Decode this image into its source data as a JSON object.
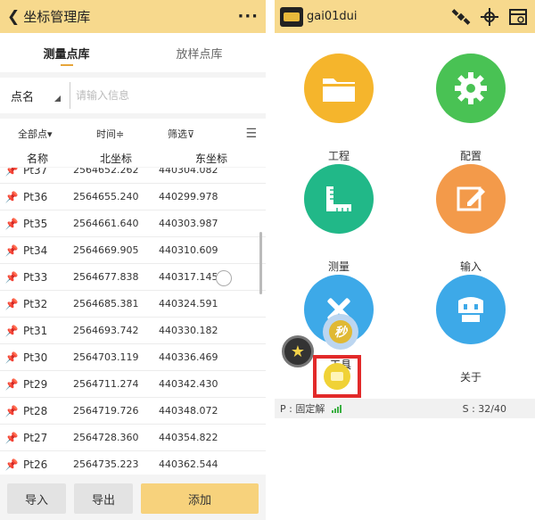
{
  "left": {
    "header": {
      "title": "坐标管理库",
      "back_icon": "chevron-left-icon",
      "more_label": "···"
    },
    "tabs": [
      {
        "label": "测量点库",
        "active": true
      },
      {
        "label": "放样点库",
        "active": false
      }
    ],
    "search": {
      "field_label": "点名",
      "placeholder": "请输入信息",
      "value": ""
    },
    "filters": {
      "all_points": "全部点▾",
      "time": "时间≑",
      "filter": "筛选⊽"
    },
    "columns": {
      "name": "名称",
      "north": "北坐标",
      "east": "东坐标"
    },
    "rows": [
      {
        "name": "Pt37",
        "north": "2564652.262",
        "east": "440304.082"
      },
      {
        "name": "Pt36",
        "north": "2564655.240",
        "east": "440299.978"
      },
      {
        "name": "Pt35",
        "north": "2564661.640",
        "east": "440303.987"
      },
      {
        "name": "Pt34",
        "north": "2564669.905",
        "east": "440310.609"
      },
      {
        "name": "Pt33",
        "north": "2564677.838",
        "east": "440317.145"
      },
      {
        "name": "Pt32",
        "north": "2564685.381",
        "east": "440324.591"
      },
      {
        "name": "Pt31",
        "north": "2564693.742",
        "east": "440330.182"
      },
      {
        "name": "Pt30",
        "north": "2564703.119",
        "east": "440336.469"
      },
      {
        "name": "Pt29",
        "north": "2564711.274",
        "east": "440342.430"
      },
      {
        "name": "Pt28",
        "north": "2564719.726",
        "east": "440348.072"
      },
      {
        "name": "Pt27",
        "north": "2564728.360",
        "east": "440354.822"
      },
      {
        "name": "Pt26",
        "north": "2564735.223",
        "east": "440362.544"
      }
    ],
    "buttons": {
      "import": "导入",
      "export": "导出",
      "add": "添加"
    }
  },
  "right": {
    "header": {
      "device": "gai01dui"
    },
    "menu": [
      {
        "label": "工程",
        "icon": "folder-icon",
        "color": "#f5b52c"
      },
      {
        "label": "配置",
        "icon": "gear-icon",
        "color": "#49c254"
      },
      {
        "label": "测量",
        "icon": "ruler-icon",
        "color": "#21b888"
      },
      {
        "label": "输入",
        "icon": "edit-icon",
        "color": "#f39a4a"
      },
      {
        "label": "工具",
        "icon": "tools-icon",
        "color": "#3da9e8"
      },
      {
        "label": "关于",
        "icon": "receiver-icon",
        "color": "#3da9e8"
      }
    ],
    "floating": {
      "sec_label": "秒"
    },
    "status": {
      "position": "P : 固定解",
      "satellites": "S : 32/40"
    }
  },
  "colors": {
    "header_bg": "#f7d98d",
    "accent_gold": "#f7d27c"
  }
}
